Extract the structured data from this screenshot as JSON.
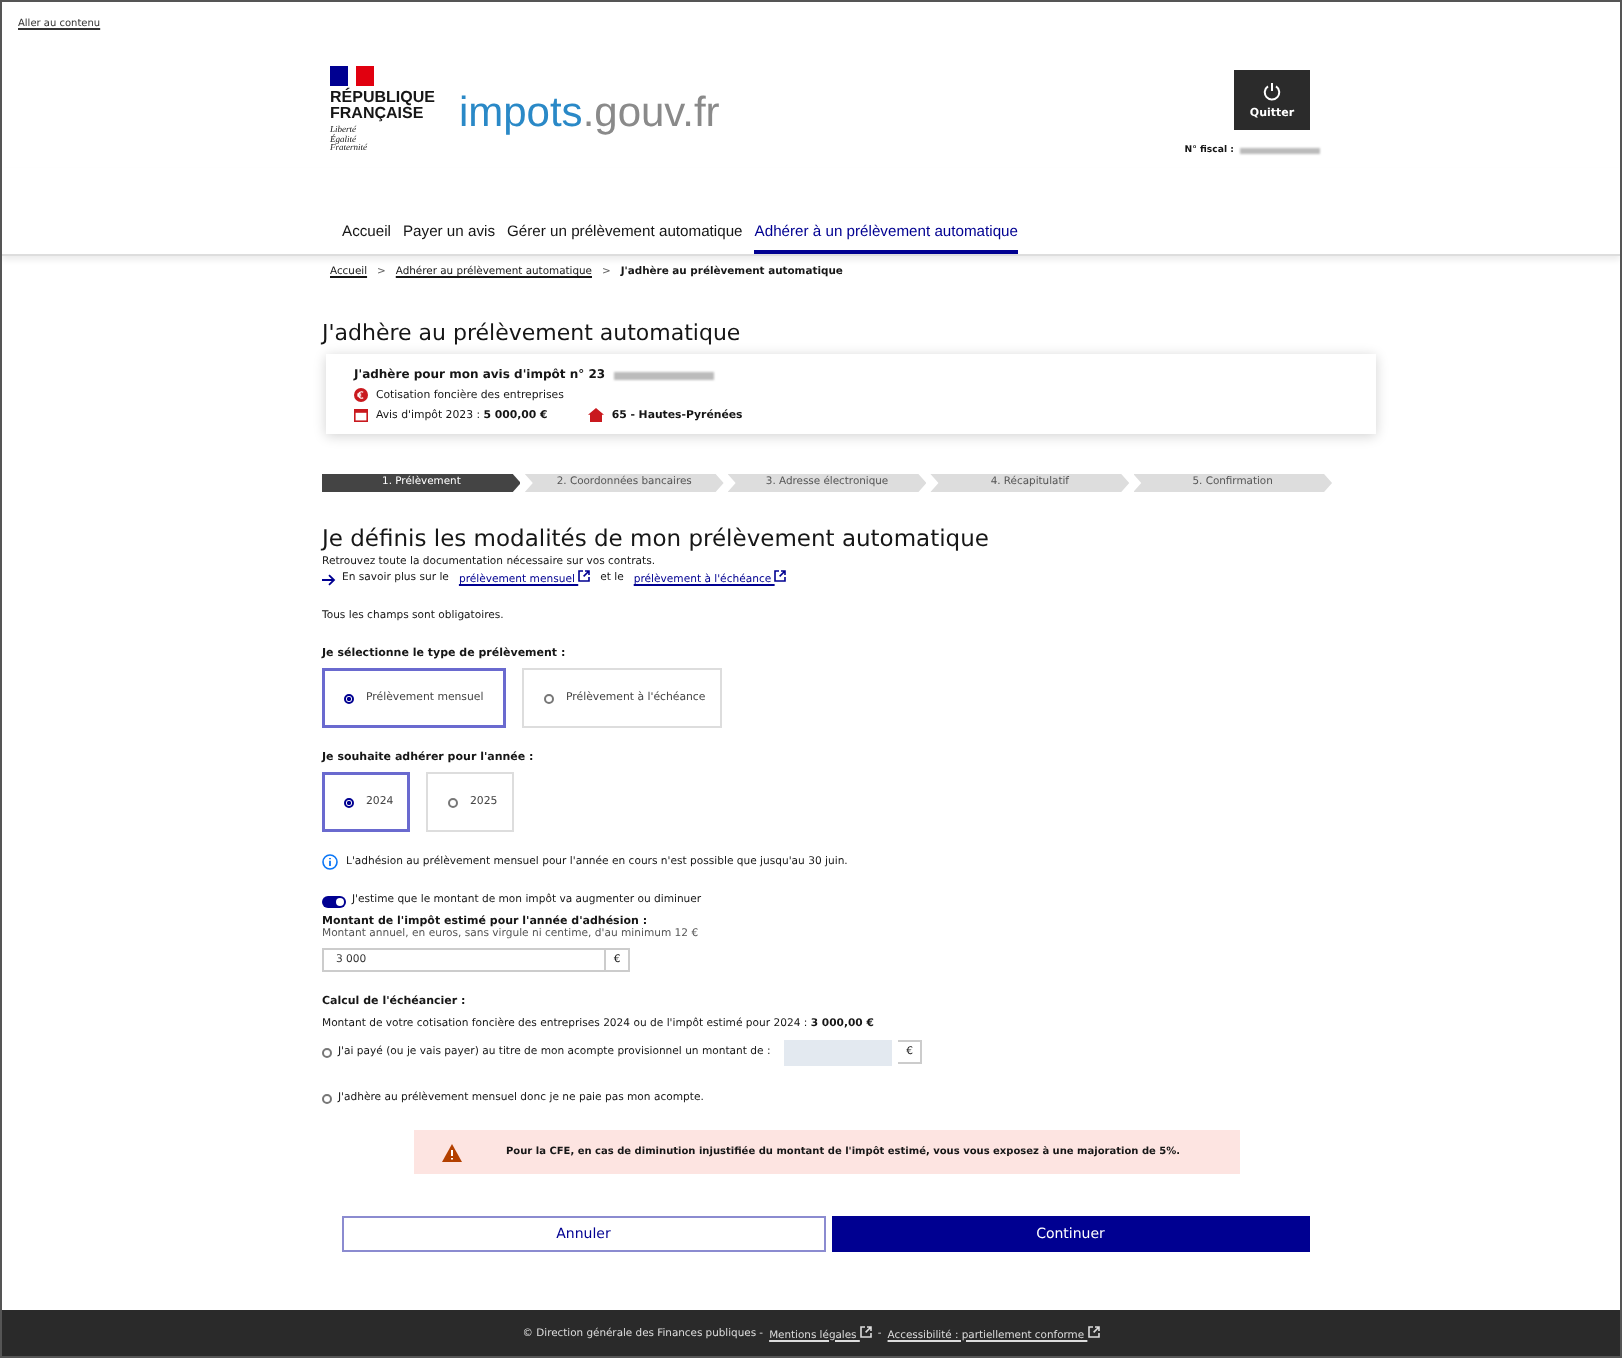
{
  "skip_link": "Aller au contenu",
  "header": {
    "republic": [
      "RÉPUBLIQUE",
      "FRANÇAISE"
    ],
    "motto": [
      "Liberté",
      "Égalité",
      "Fraternité"
    ],
    "brand": {
      "name": "impots",
      "domain": ".gouv.fr"
    },
    "quit_button": "Quitter",
    "fiscal_label": "N° fiscal :"
  },
  "nav": [
    {
      "label": "Accueil",
      "selected": false
    },
    {
      "label": "Payer un avis",
      "selected": false
    },
    {
      "label": "Gérer un prélèvement automatique",
      "selected": false
    },
    {
      "label": "Adhérer à un prélèvement automatique",
      "selected": true
    }
  ],
  "breadcrumb_separator": ">",
  "breadcrumb": [
    {
      "label": "Accueil",
      "kind": "link"
    },
    {
      "label": "Adhérer au prélèvement automatique",
      "kind": "link"
    },
    {
      "label": "J'adhère au prélèvement automatique",
      "kind": "current"
    }
  ],
  "page_title": "J'adhère au prélèvement automatique",
  "summary": {
    "title": "J'adhère pour mon avis d'impôt n° 23",
    "tax_type": "Cotisation foncière des entreprises",
    "notice_label": "Avis d'impôt 2023 :",
    "notice_amount": "5 000,00 €",
    "department": "65 - Hautes-Pyrénées"
  },
  "steps": [
    {
      "label": "1. Prélèvement",
      "selected": true
    },
    {
      "label": "2. Coordonnées bancaires",
      "selected": false
    },
    {
      "label": "3. Adresse électronique",
      "selected": false
    },
    {
      "label": "4. Récapitulatif",
      "selected": false
    },
    {
      "label": "5. Confirmation",
      "selected": false
    }
  ],
  "section_title": "Je définis les modalités de mon prélèvement automatique",
  "doc_intro": "Retrouvez toute la documentation nécessaire sur vos contrats.",
  "doc_links": [
    {
      "kind": "text",
      "text": "En savoir plus sur le"
    },
    {
      "kind": "link",
      "text": "prélèvement mensuel"
    },
    {
      "kind": "text",
      "text": "et le"
    },
    {
      "kind": "link",
      "text": "prélèvement à l'échéance"
    }
  ],
  "required_note": "Tous les champs sont obligatoires.",
  "type_group": {
    "label": "Je sélectionne le type de prélèvement :",
    "options": [
      {
        "label": "Prélèvement mensuel",
        "selected": true
      },
      {
        "label": "Prélèvement à l'échéance",
        "selected": false
      }
    ]
  },
  "year_group": {
    "label": "Je souhaite adhérer pour l'année :",
    "options": [
      {
        "label": "2024",
        "selected": true
      },
      {
        "label": "2025",
        "selected": false
      }
    ]
  },
  "info": "L'adhésion au prélèvement mensuel pour l'année en cours n'est possible que jusqu'au 30 juin.",
  "estimate_toggle": {
    "label": "J'estime que le montant de mon impôt va augmenter ou diminuer",
    "on": true
  },
  "estimate_field": {
    "label": "Montant de l'impôt estimé pour l'année d'adhésion :",
    "hint": "Montant annuel, en euros, sans virgule ni centime, d'au minimum 12 €",
    "value": "3 000",
    "unit": "€"
  },
  "schedule": {
    "title": "Calcul de l'échéancier :",
    "amount_text": "Montant de votre cotisation foncière des entreprises 2024 ou de l'impôt estimé pour 2024 :",
    "amount_value": "3 000,00 €",
    "options": [
      {
        "kind": "amount",
        "label": "J'ai payé (ou je vais payer) au titre de mon acompte provisionnel un montant de :",
        "unit": "€",
        "selected": false
      },
      {
        "kind": "plain",
        "label": "J'adhère au prélèvement mensuel donc je ne paie pas mon acompte.",
        "selected": false
      }
    ]
  },
  "warning": "Pour la CFE, en cas de diminution injustifiée du montant de l'impôt estimé, vous vous exposez à une majoration de 5%.",
  "buttons": {
    "cancel": "Annuler",
    "continue": "Continuer"
  },
  "footer": [
    {
      "kind": "text",
      "text": "© Direction générale des Finances publiques -"
    },
    {
      "kind": "link",
      "text": "Mentions légales"
    },
    {
      "kind": "text",
      "text": "-"
    },
    {
      "kind": "link",
      "text": "Accessibilité : partiellement conforme"
    }
  ]
}
